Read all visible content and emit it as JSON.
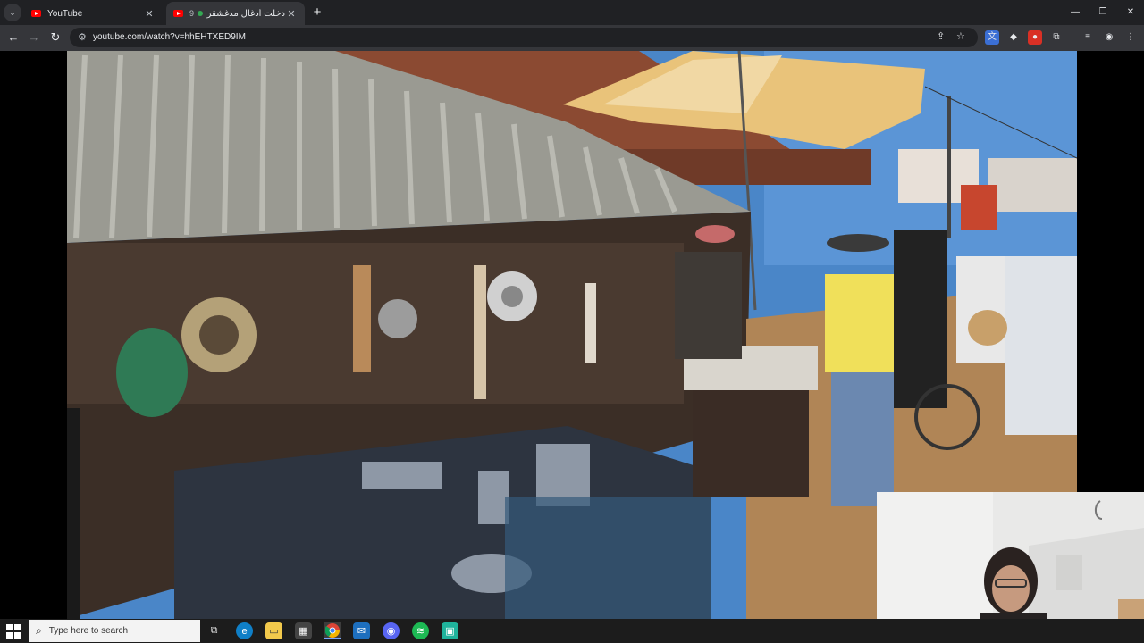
{
  "browser": {
    "tab_search_label": "⌄",
    "tabs": [
      {
        "title": "YouTube",
        "close": "✕"
      },
      {
        "title": "دخلت أدغال مدغشقر 🔊",
        "prefix": "9",
        "close": "✕"
      }
    ],
    "new_tab": "+",
    "window_controls": {
      "minimize": "—",
      "restore": "❐",
      "close": "✕"
    },
    "nav": {
      "back": "←",
      "forward": "→",
      "reload": "↻"
    },
    "address": {
      "url": "youtube.com/watch?v=hhEHTXED9IM"
    }
  },
  "video": {
    "description_colors": {
      "sky": "#4a86c8",
      "roof": "#9a9a92",
      "tile": "#8b4a32",
      "umbrella": "#e9c37a"
    }
  },
  "taskbar": {
    "search_placeholder": "Type here to search",
    "apps": [
      "task-view",
      "edge",
      "file-explorer",
      "store",
      "chrome",
      "vpn",
      "discord",
      "spotify",
      "app"
    ]
  }
}
